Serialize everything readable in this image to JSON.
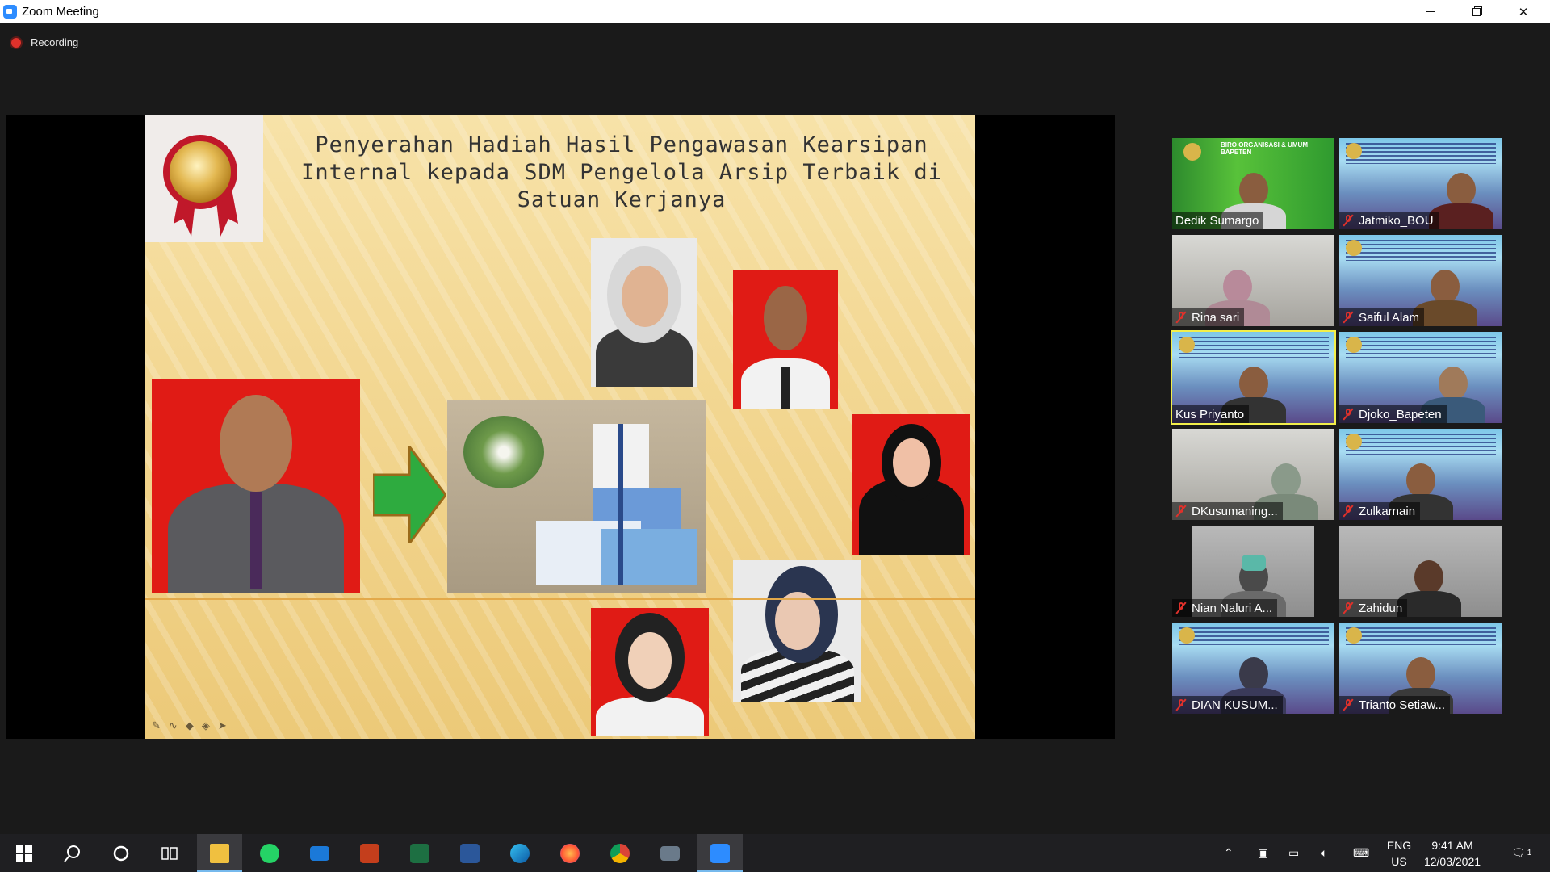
{
  "window": {
    "title": "Zoom Meeting"
  },
  "meeting": {
    "recording_label": "Recording"
  },
  "slide": {
    "title": "Penyerahan Hadiah Hasil Pengawasan Kearsipan Internal kepada SDM Pengelola Arsip Terbaik di Satuan Kerjanya"
  },
  "participants": [
    {
      "name": "Dedik Sumargo",
      "muted": false,
      "background": "green",
      "banner_text": "BIRO ORGANISASI & UMUM BAPETEN"
    },
    {
      "name": "Jatmiko_BOU",
      "muted": true,
      "background": "banner"
    },
    {
      "name": "Rina sari",
      "muted": true,
      "background": "room"
    },
    {
      "name": "Saiful Alam",
      "muted": true,
      "background": "banner"
    },
    {
      "name": "Kus Priyanto",
      "muted": false,
      "background": "banner",
      "active_speaker": true
    },
    {
      "name": "Djoko_Bapeten",
      "muted": true,
      "background": "banner"
    },
    {
      "name": "DKusumaning...",
      "muted": true,
      "background": "room"
    },
    {
      "name": "Zulkarnain",
      "muted": true,
      "background": "banner"
    },
    {
      "name": "Nian Naluri A...",
      "muted": true,
      "background": "room"
    },
    {
      "name": "Zahidun",
      "muted": true,
      "background": "grey"
    },
    {
      "name": "DIAN KUSUM...",
      "muted": true,
      "background": "banner"
    },
    {
      "name": "Trianto Setiaw...",
      "muted": true,
      "background": "banner"
    }
  ],
  "taskbar": {
    "apps": [
      "start-icon",
      "search-icon",
      "cortana-icon",
      "task-view-icon",
      "file-explorer-icon",
      "whatsapp-icon",
      "mail-icon",
      "powerpoint-icon",
      "excel-icon",
      "word-icon",
      "edge-icon",
      "firefox-icon",
      "chrome-icon",
      "camera-icon",
      "zoom-icon"
    ],
    "language": "ENG",
    "region": "US",
    "time": "9:41 AM",
    "date": "12/03/2021",
    "notification_count": "1"
  },
  "colors": {
    "accent": "#2d8cff",
    "active_speaker": "#f3ef4a",
    "recording": "#e0312b"
  }
}
